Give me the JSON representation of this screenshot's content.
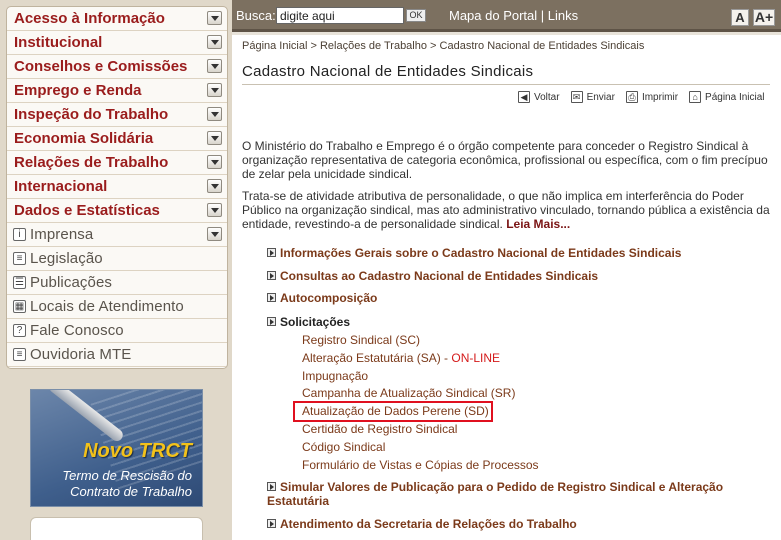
{
  "sidebar": {
    "menu": [
      {
        "label": "Acesso à Informação",
        "type": "dropdown"
      },
      {
        "label": "Institucional",
        "type": "dropdown"
      },
      {
        "label": "Conselhos e Comissões",
        "type": "dropdown"
      },
      {
        "label": "Emprego e Renda",
        "type": "dropdown"
      },
      {
        "label": "Inspeção do Trabalho",
        "type": "dropdown"
      },
      {
        "label": "Economia Solidária",
        "type": "dropdown"
      },
      {
        "label": "Relações de Trabalho",
        "type": "dropdown"
      },
      {
        "label": "Internacional",
        "type": "dropdown"
      },
      {
        "label": "Dados e Estatísticas",
        "type": "dropdown"
      },
      {
        "label": "Imprensa",
        "type": "plain-dropdown",
        "icon": "info-icon"
      },
      {
        "label": "Legislação",
        "type": "plain",
        "icon": "document-icon"
      },
      {
        "label": "Publicações",
        "type": "plain",
        "icon": "book-icon"
      },
      {
        "label": "Locais de Atendimento",
        "type": "plain",
        "icon": "grid-icon"
      },
      {
        "label": "Fale Conosco",
        "type": "plain",
        "icon": "question-icon"
      },
      {
        "label": "Ouvidoria MTE",
        "type": "plain",
        "icon": "chat-icon"
      }
    ],
    "banner": {
      "title": "Novo TRCT",
      "subtitle": "Termo de Rescisão do Contrato de Trabalho"
    }
  },
  "topbar": {
    "search_label": "Busca:",
    "search_value": "digite aqui",
    "ok_label": "OK",
    "nav": "Mapa do Portal | Links",
    "font_small": "A",
    "font_large": "A+"
  },
  "content": {
    "breadcrumb": "Página Inicial > Relações de Trabalho > Cadastro Nacional de Entidades Sindicais",
    "title": "Cadastro Nacional de Entidades Sindicais",
    "tools": {
      "back": "Voltar",
      "send": "Enviar",
      "print": "Imprimir",
      "home": "Página Inicial"
    },
    "para1": "O Ministério do Trabalho e Emprego é o órgão competente para conceder o Registro Sindical à organização representativa de categoria econômica, profissional ou específica, com o fim precípuo de zelar pela unicidade sindical.",
    "para2": "Trata-se de atividade atributiva de personalidade, o que não implica em interferência do Poder Público na organização sindical, mas ato administrativo vinculado, tornando pública a existência da entidade, revestindo-a de personalidade sindical.",
    "read_more": "Leia Mais...",
    "sections": {
      "s1": "Informações Gerais sobre o Cadastro Nacional de Entidades Sindicais",
      "s2": "Consultas ao Cadastro Nacional de Entidades Sindicais",
      "s3": "Autocomposição",
      "s4": "Solicitações",
      "s5": "Simular Valores de Publicação para o Pedido de Registro Sindical e Alteração Estatutária",
      "s6": "Atendimento da Secretaria de Relações do Trabalho"
    },
    "solicitacoes": {
      "i1": "Registro Sindical (SC)",
      "i2a": "Alteração Estatutária (SA) - ",
      "i2b": "ON-LINE",
      "i3": "Impugnação",
      "i4": "Campanha de Atualização Sindical (SR)",
      "i5": "Atualização de Dados Perene (SD)",
      "i6": "Certidão de Registro Sindical",
      "i7": "Código Sindical",
      "i8": "Formulário de Vistas e Cópias de Processos"
    }
  }
}
